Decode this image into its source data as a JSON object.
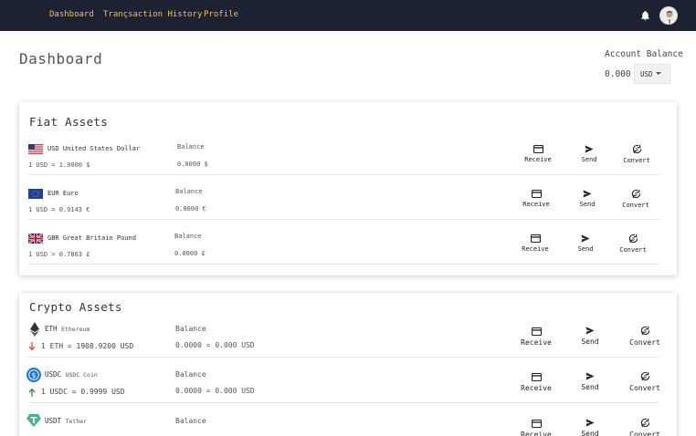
{
  "nav": {
    "dashboard": "Dashboard",
    "history": "Trançsaction History",
    "profile": "Profile"
  },
  "page": {
    "title": "Dashboard"
  },
  "account": {
    "label": "Account Balance",
    "amount": "0.000",
    "currency": "USD"
  },
  "actions": {
    "receive": "Receive",
    "send": "Send",
    "convert": "Convert"
  },
  "fiat": {
    "title": "Fiat Assets",
    "balance_header": "Balance",
    "rows": [
      {
        "code": "USD",
        "name": "United States Dollar",
        "rate": "1 USD = 1.0000 $",
        "balance": "0.0000 $",
        "flag": "us-flag-icon"
      },
      {
        "code": "EUR",
        "name": "Euro",
        "rate": "1 USD = 0.9143 €",
        "balance": "0.0000 €",
        "flag": "eu-flag-icon"
      },
      {
        "code": "GBR",
        "name": "Great Britain Pound",
        "rate": "1 USD = 0.7863 £",
        "balance": "0.0000 £",
        "flag": "uk-flag-icon"
      }
    ]
  },
  "crypto": {
    "title": "Crypto Assets",
    "balance_header": "Balance",
    "rows": [
      {
        "code": "ETH",
        "name": "Ethereum",
        "rate": "1 ETH = 1908.9200 USD",
        "balance": "0.0000 = 0.000 USD",
        "trend": "down",
        "icon": "ethereum-icon"
      },
      {
        "code": "USDC",
        "name": "USDC Coin",
        "rate": "1 USDC = 0.9999 USD",
        "balance": "0.0000 = 0.000 USD",
        "trend": "up",
        "icon": "usdc-icon"
      },
      {
        "code": "USDT",
        "name": "Tether",
        "rate": "",
        "balance": "",
        "trend": "up",
        "icon": "tether-icon"
      }
    ]
  },
  "colors": {
    "topbar": "#1c2231",
    "nav_text": "#f3c24a",
    "down": "#e53935",
    "up": "#2e7d32",
    "usdc": "#2775ca",
    "tether": "#50af95"
  }
}
